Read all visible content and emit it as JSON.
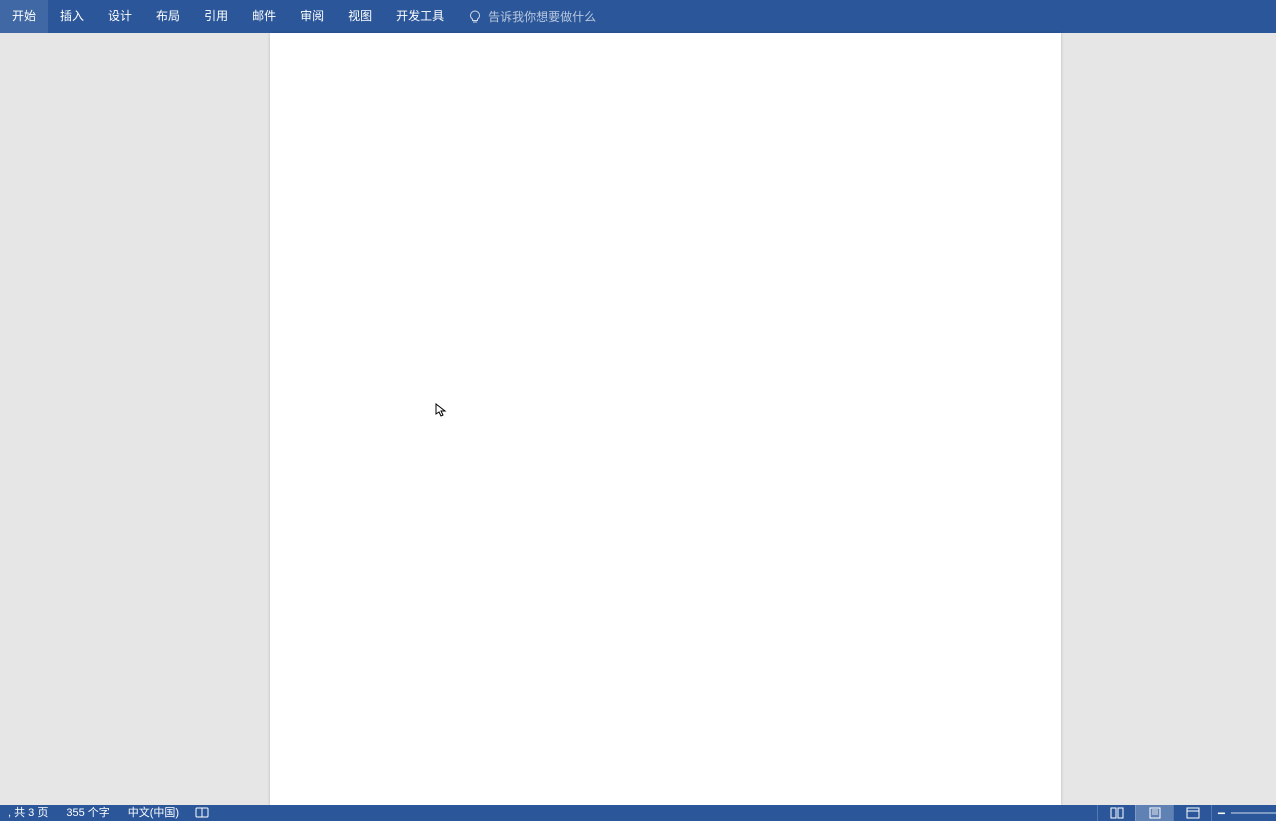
{
  "ribbon": {
    "tabs": [
      {
        "label": "开始"
      },
      {
        "label": "插入"
      },
      {
        "label": "设计"
      },
      {
        "label": "布局"
      },
      {
        "label": "引用"
      },
      {
        "label": "邮件"
      },
      {
        "label": "审阅"
      },
      {
        "label": "视图"
      },
      {
        "label": "开发工具"
      }
    ],
    "search_placeholder": "告诉我你想要做什么"
  },
  "status": {
    "page_info": ", 共 3 页",
    "word_count": "355 个字",
    "language": "中文(中国)"
  },
  "colors": {
    "ribbon_bg": "#2b579a",
    "content_bg": "#e6e6e6",
    "page_bg": "#ffffff"
  }
}
